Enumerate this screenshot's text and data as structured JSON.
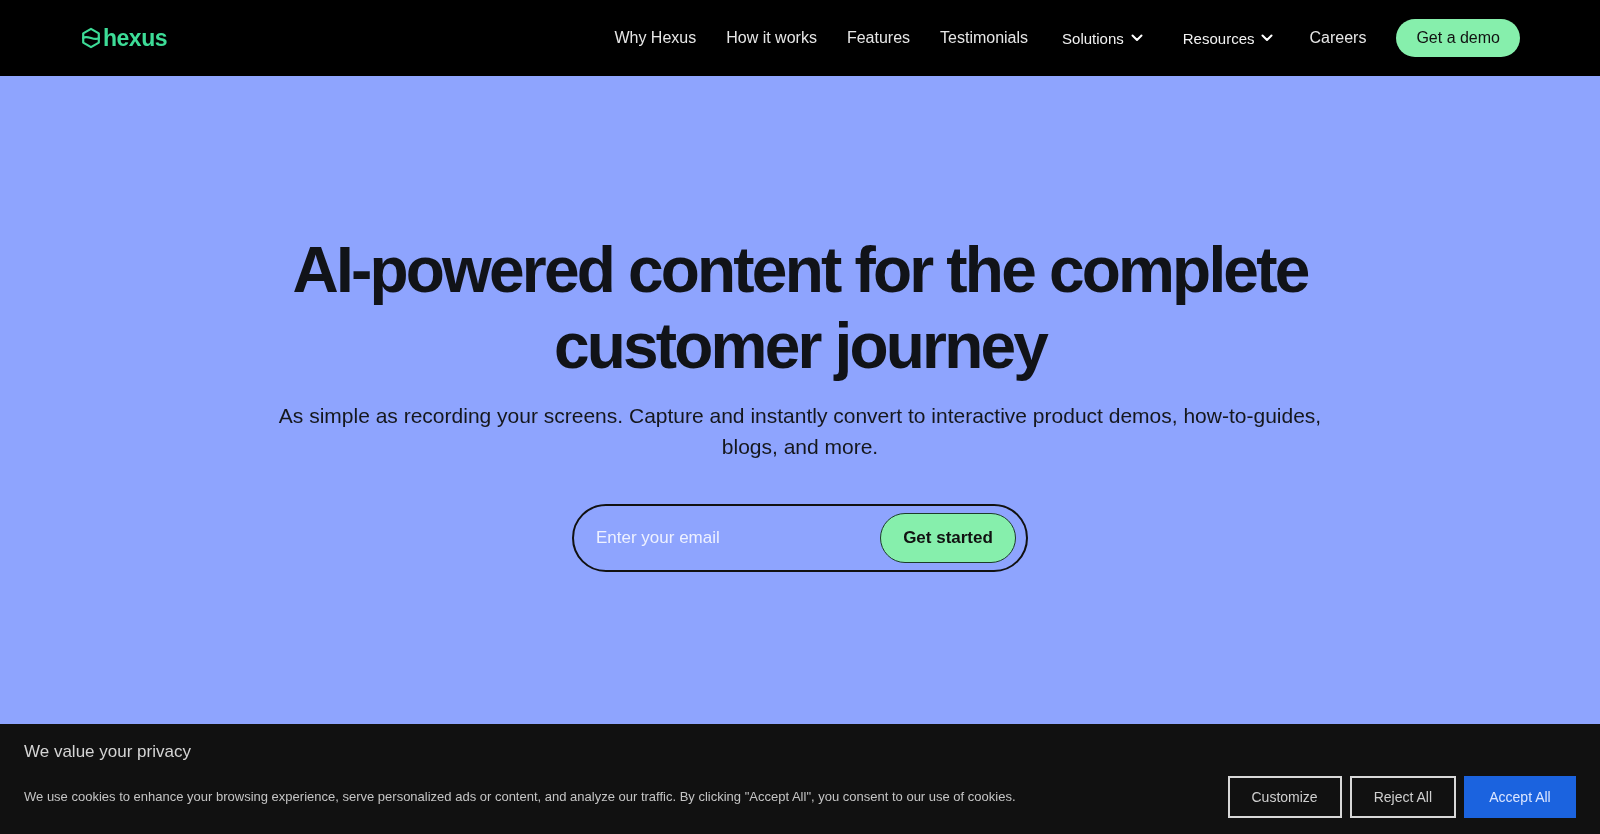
{
  "nav": {
    "logo": "hexus",
    "links": [
      {
        "label": "Why Hexus",
        "kind": "link"
      },
      {
        "label": "How it works",
        "kind": "link"
      },
      {
        "label": "Features",
        "kind": "link"
      },
      {
        "label": "Testimonials",
        "kind": "link"
      },
      {
        "label": "Solutions",
        "kind": "dropdown"
      },
      {
        "label": "Resources",
        "kind": "dropdown"
      },
      {
        "label": "Careers",
        "kind": "link"
      }
    ],
    "cta": "Get a demo"
  },
  "hero": {
    "heading": "AI-powered content for the complete customer journey",
    "subheading": "As simple as recording your screens. Capture and instantly convert to interactive product demos, how-to-guides, blogs, and more.",
    "email_form": {
      "placeholder": "Enter your email",
      "button": "Get started"
    }
  },
  "cookie_banner": {
    "title": "We value your privacy",
    "text": "We use cookies to enhance your browsing experience, serve personalized ads or content, and analyze our traffic. By clicking \"Accept All\", you consent to our use of cookies.",
    "buttons": [
      {
        "label": "Customize",
        "kind": "outline"
      },
      {
        "label": "Reject All",
        "kind": "outline"
      },
      {
        "label": "Accept All",
        "kind": "primary"
      }
    ]
  }
}
